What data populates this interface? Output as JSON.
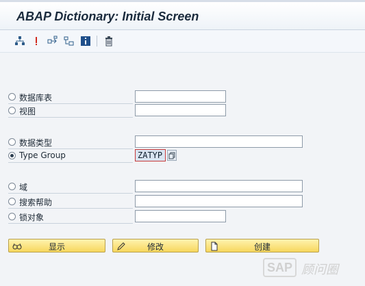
{
  "window": {
    "title": "ABAP Dictionary: Initial Screen"
  },
  "toolbar": {
    "buttons": [
      {
        "icon": "hierarchy-icon"
      },
      {
        "icon": "where-used-icon"
      },
      {
        "icon": "move-icon"
      },
      {
        "icon": "other-object-icon"
      },
      {
        "icon": "info-icon"
      },
      {
        "icon": "delete-icon"
      }
    ]
  },
  "options": [
    {
      "label": "数据库表",
      "value": "",
      "selected": false
    },
    {
      "label": "视图",
      "value": "",
      "selected": false
    },
    {
      "label": "数据类型",
      "value": "",
      "selected": false
    },
    {
      "label": "Type Group",
      "value": "ZATYP",
      "selected": true
    },
    {
      "label": "域",
      "value": "",
      "selected": false
    },
    {
      "label": "搜索帮助",
      "value": "",
      "selected": false
    },
    {
      "label": "锁对象",
      "value": "",
      "selected": false
    }
  ],
  "actions": {
    "display_label": "显示",
    "change_label": "修改",
    "create_label": "创建"
  },
  "watermark": {
    "brand": "SAP",
    "text": "顾问圈"
  }
}
